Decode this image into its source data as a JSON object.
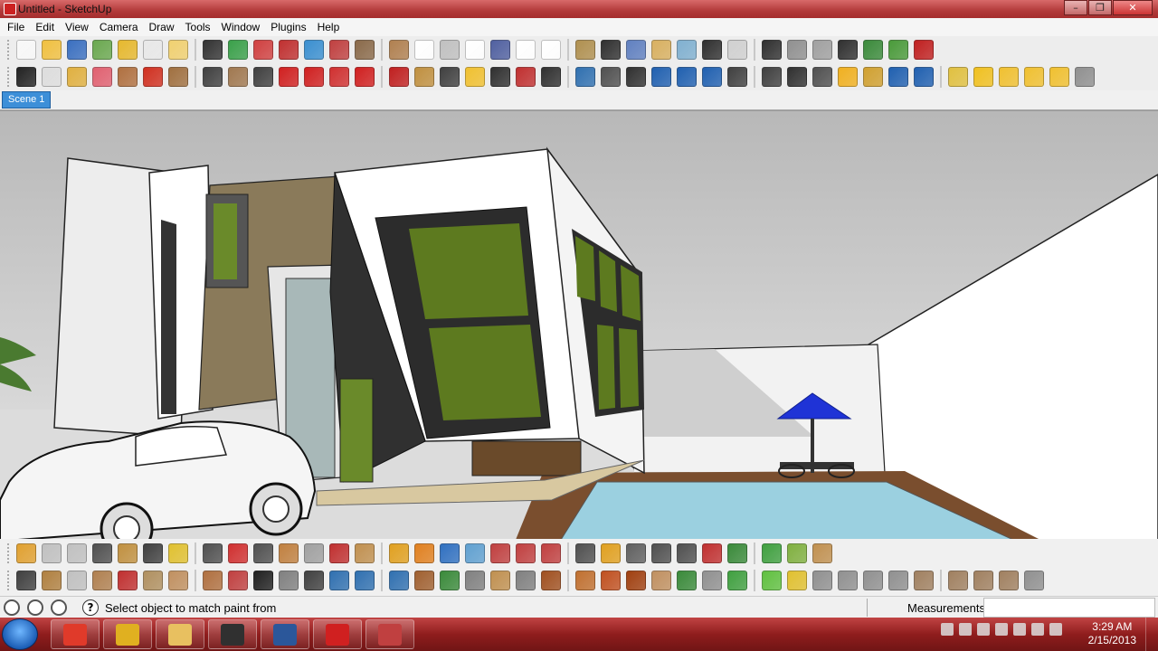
{
  "window": {
    "title": "Untitled - SketchUp",
    "min": "–",
    "max": "❐",
    "close": "✕"
  },
  "menu": [
    "File",
    "Edit",
    "View",
    "Camera",
    "Draw",
    "Tools",
    "Window",
    "Plugins",
    "Help"
  ],
  "scenes": {
    "active": "Scene 1"
  },
  "toolbar_top": {
    "row1_colors": [
      "#f8f8f8",
      "#f0c040",
      "#3a6fc0",
      "#6aa84f",
      "#e6b82e",
      "#e8e8e8",
      "#f0d070",
      "#333333",
      "#3aa04a",
      "#d04040",
      "#c03030",
      "#3a8fd0",
      "#c04040",
      "#8a6a4a",
      "#b08050",
      "#ffffff",
      "#c0c0c0",
      "#ffffff",
      "#5060a0",
      "#ffffff",
      "#ffffff",
      "#b09050",
      "#303030",
      "#6080c0",
      "#d8b060",
      "#80b0d0",
      "#303030",
      "#d0d0d0",
      "#303030",
      "#909090",
      "#a0a0a0",
      "#303030",
      "#3a8a3a",
      "#4a9a3a",
      "#c02020"
    ],
    "row2_colors": [
      "#222222",
      "#dddddd",
      "#e0b040",
      "#e06070",
      "#b07040",
      "#d03020",
      "#a07040",
      "#404040",
      "#a07850",
      "#404040",
      "#d02020",
      "#d02020",
      "#d03030",
      "#d02020",
      "#c02020",
      "#c09040",
      "#404040",
      "#f0c030",
      "#303030",
      "#c03030",
      "#303030",
      "#3070b0",
      "#505050",
      "#303030",
      "#2060b0",
      "#2060b0",
      "#2060b0",
      "#404040",
      "#404040",
      "#303030",
      "#505050",
      "#f0b020",
      "#d0a030",
      "#2060b0",
      "#2060b0",
      "#e0c040",
      "#f0c020",
      "#f0c030",
      "#f0c030",
      "#f0c030",
      "#909090"
    ]
  },
  "toolbar_bottom": {
    "row1_colors": [
      "#e0a030",
      "#c0c0c0",
      "#c0c0c0",
      "#505050",
      "#c09040",
      "#404040",
      "#e0c030",
      "#505050",
      "#d03030",
      "#505050",
      "#c08040",
      "#a0a0a0",
      "#c03030",
      "#c09050",
      "#e0a020",
      "#e08020",
      "#3070c0",
      "#60a0d0",
      "#c04040",
      "#c04040",
      "#c04040",
      "#505050",
      "#e0a020",
      "#606060",
      "#505050",
      "#505050",
      "#c03030",
      "#3a8a3a",
      "#40a040",
      "#80b040",
      "#c09050"
    ],
    "row2_colors": [
      "#404040",
      "#b08040",
      "#c0c0c0",
      "#b08050",
      "#c03030",
      "#b09060",
      "#c09060",
      "#b07040",
      "#c04040",
      "#202020",
      "#808080",
      "#404040",
      "#3070b0",
      "#3070b0",
      "#3070b0",
      "#a06030",
      "#3a8a3a",
      "#808080",
      "#c09050",
      "#808080",
      "#a05020",
      "#c07030",
      "#c05020",
      "#a04010",
      "#c09060",
      "#3a8a3a",
      "#909090",
      "#40a040",
      "#60c040",
      "#e0c030",
      "#909090",
      "#909090",
      "#909090",
      "#909090",
      "#a08060",
      "#a08060",
      "#a08060",
      "#a08060",
      "#909090"
    ]
  },
  "status": {
    "text": "Select object to match paint from",
    "measurements_label": "Measurements",
    "help": "?"
  },
  "taskbar": {
    "apps": [
      {
        "name": "chrome",
        "color": "#e03a2a"
      },
      {
        "name": "sketchup-pro",
        "color": "#e0b020"
      },
      {
        "name": "explorer",
        "color": "#e8c060"
      },
      {
        "name": "media-player-classic",
        "color": "#303030"
      },
      {
        "name": "word",
        "color": "#2b579a"
      },
      {
        "name": "sketchup",
        "color": "#d02020"
      },
      {
        "name": "ccleaner",
        "color": "#c04040"
      }
    ],
    "clock_time": "3:29 AM",
    "clock_date": "2/15/2013"
  }
}
